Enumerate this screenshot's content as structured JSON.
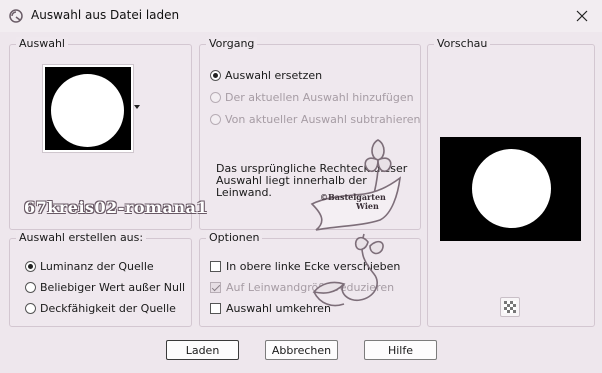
{
  "window": {
    "title": "Auswahl aus Datei laden"
  },
  "groups": {
    "auswahl": {
      "label": "Auswahl"
    },
    "vorgang": {
      "label": "Vorgang",
      "options": [
        {
          "label": "Auswahl ersetzen",
          "checked": true,
          "disabled": false
        },
        {
          "label": "Der aktuellen Auswahl hinzufügen",
          "checked": false,
          "disabled": true
        },
        {
          "label": "Von aktueller Auswahl subtrahieren",
          "checked": false,
          "disabled": true
        }
      ],
      "info_line1": "Das ursprüngliche Rechteck dieser",
      "info_line2": "Auswahl liegt innerhalb der",
      "info_line3": "Leinwand."
    },
    "vorschau": {
      "label": "Vorschau"
    },
    "erstellen": {
      "label": "Auswahl erstellen aus:",
      "options": [
        {
          "label": "Luminanz der Quelle",
          "checked": true
        },
        {
          "label": "Beliebiger Wert außer Null",
          "checked": false
        },
        {
          "label": "Deckfähigkeit der Quelle",
          "checked": false
        }
      ]
    },
    "optionen": {
      "label": "Optionen",
      "checks": [
        {
          "label": "In obere linke Ecke verschieben",
          "checked": false,
          "disabled": false
        },
        {
          "label": "Auf Leinwandgröße reduzieren",
          "checked": true,
          "disabled": true
        },
        {
          "label": "Auswahl umkehren",
          "checked": false,
          "disabled": false
        }
      ]
    }
  },
  "buttons": {
    "load": "Laden",
    "cancel": "Abbrechen",
    "help": "Hilfe"
  },
  "overlay": {
    "filename": "67kreis02-romana1",
    "watermark_line1": "©Bastelgarten",
    "watermark_line2": "Wien"
  },
  "icons": {
    "app": "selection-icon",
    "close": "close-icon",
    "dropdown": "dropdown-arrow-icon",
    "transparency": "checkerboard-icon"
  },
  "colors": {
    "accent": "#222222",
    "window_bg": "#eee7ed",
    "border": "#d3c7d1"
  }
}
